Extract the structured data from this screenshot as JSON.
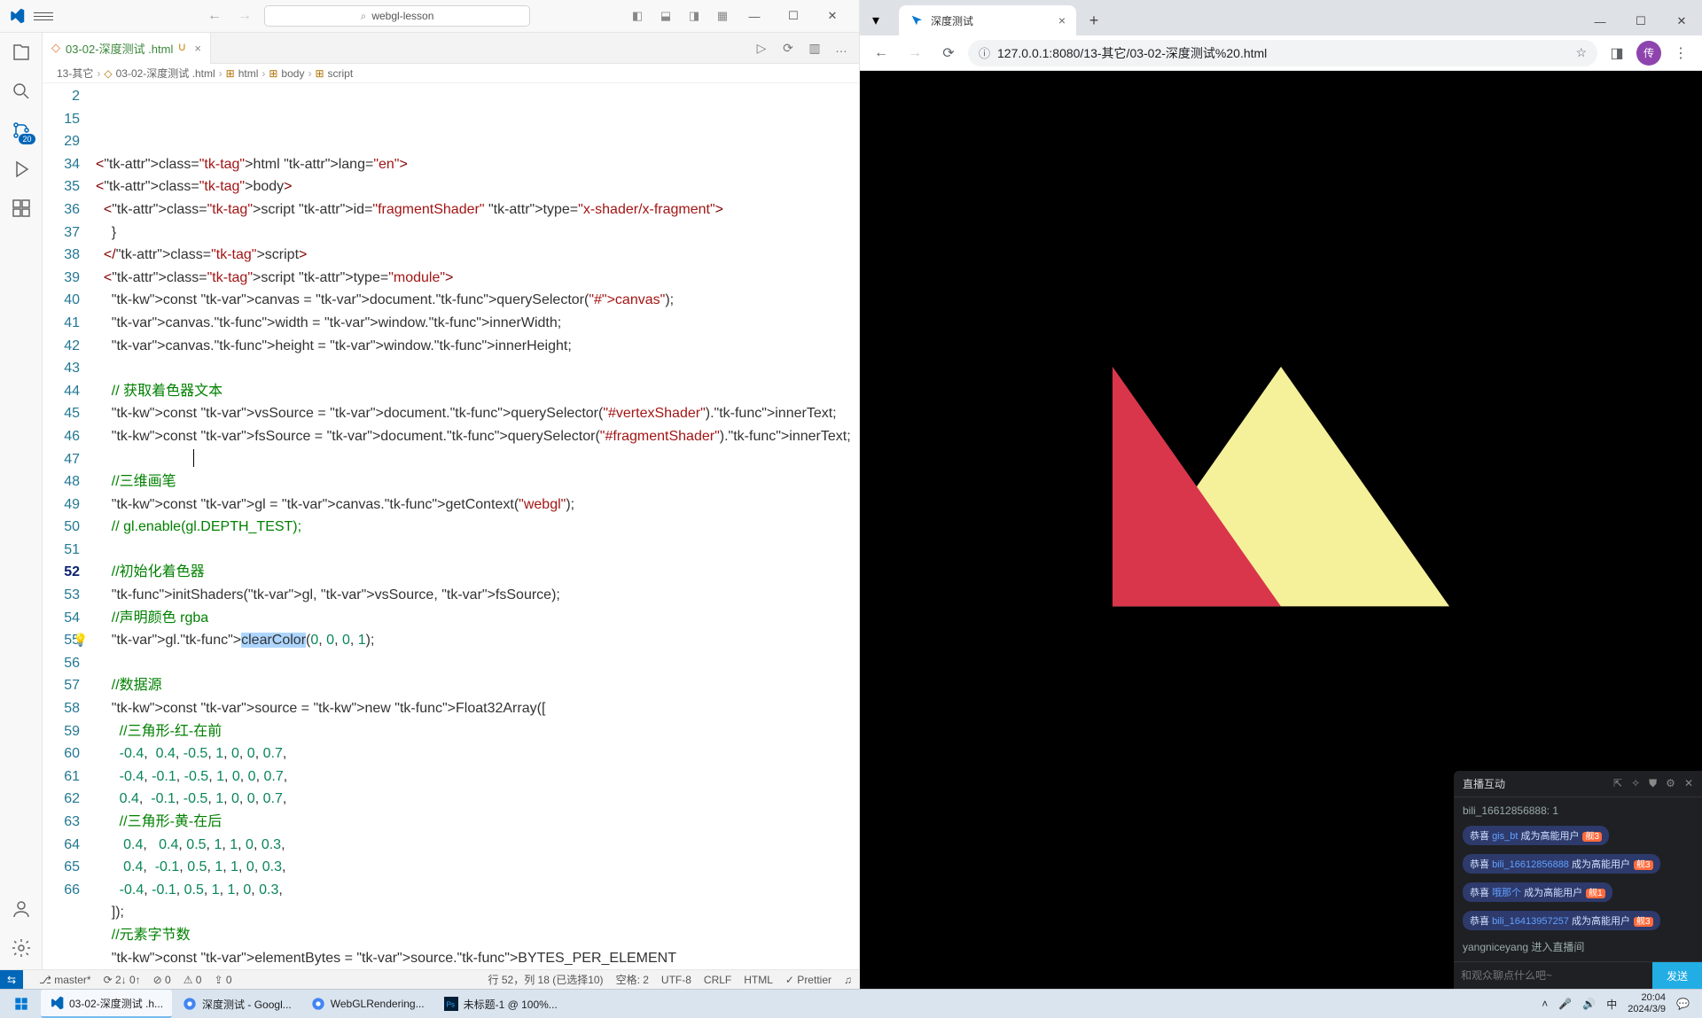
{
  "vscode": {
    "search_placeholder": "webgl-lesson",
    "tab": {
      "label": "03-02-深度测试 .html",
      "modified": "U"
    },
    "editor_actions": {
      "run": "▷",
      "debug": "⟳",
      "split": "▥",
      "more": "…"
    },
    "breadcrumb": [
      "13-其它",
      "03-02-深度测试 .html",
      "html",
      "body",
      "script"
    ],
    "activity_badge": "20",
    "code": {
      "line_numbers": [
        2,
        15,
        29,
        34,
        35,
        36,
        37,
        38,
        39,
        40,
        41,
        42,
        43,
        44,
        45,
        46,
        47,
        48,
        49,
        50,
        51,
        52,
        53,
        54,
        55,
        56,
        57,
        58,
        59,
        60,
        61,
        62,
        63,
        64,
        65,
        66
      ],
      "current_line": 52,
      "lines": [
        {
          "raw": "<html lang=\"en\">",
          "type": "html"
        },
        {
          "raw": "<body>",
          "type": "html"
        },
        {
          "raw": "  <script id=\"fragmentShader\" type=\"x-shader/x-fragment\">",
          "type": "html"
        },
        {
          "raw": "    }",
          "type": "plain"
        },
        {
          "raw": "  </script>",
          "type": "html"
        },
        {
          "raw": "  <script type=\"module\">",
          "type": "html"
        },
        {
          "raw": "    const canvas = document.querySelector(\"#canvas\");",
          "type": "js"
        },
        {
          "raw": "    canvas.width = window.innerWidth;",
          "type": "js"
        },
        {
          "raw": "    canvas.height = window.innerHeight;",
          "type": "js"
        },
        {
          "raw": "",
          "type": "plain"
        },
        {
          "raw": "    // 获取着色器文本",
          "type": "cmt"
        },
        {
          "raw": "    const vsSource = document.querySelector(\"#vertexShader\").innerText;",
          "type": "js"
        },
        {
          "raw": "    const fsSource = document.querySelector(\"#fragmentShader\").innerText;",
          "type": "js"
        },
        {
          "raw": "",
          "type": "plain"
        },
        {
          "raw": "    //三维画笔",
          "type": "cmt"
        },
        {
          "raw": "    const gl = canvas.getContext(\"webgl\");",
          "type": "js"
        },
        {
          "raw": "    // gl.enable(gl.DEPTH_TEST);",
          "type": "cmt"
        },
        {
          "raw": "",
          "type": "plain"
        },
        {
          "raw": "    //初始化着色器",
          "type": "cmt"
        },
        {
          "raw": "    initShaders(gl, vsSource, fsSource);",
          "type": "js"
        },
        {
          "raw": "    //声明颜色 rgba",
          "type": "cmt"
        },
        {
          "raw": "    gl.clearColor(0, 0, 0, 1);",
          "type": "js",
          "sel": "clearColor",
          "bulb": true
        },
        {
          "raw": "",
          "type": "plain"
        },
        {
          "raw": "    //数据源",
          "type": "cmt"
        },
        {
          "raw": "    const source = new Float32Array([",
          "type": "js"
        },
        {
          "raw": "      //三角形-红-在前",
          "type": "cmt"
        },
        {
          "raw": "      -0.4,  0.4, -0.5, 1, 0, 0, 0.7,",
          "type": "nums"
        },
        {
          "raw": "      -0.4, -0.1, -0.5, 1, 0, 0, 0.7,",
          "type": "nums"
        },
        {
          "raw": "      0.4,  -0.1, -0.5, 1, 0, 0, 0.7,",
          "type": "nums"
        },
        {
          "raw": "      //三角形-黄-在后",
          "type": "cmt"
        },
        {
          "raw": "       0.4,   0.4, 0.5, 1, 1, 0, 0.3,",
          "type": "nums"
        },
        {
          "raw": "       0.4,  -0.1, 0.5, 1, 1, 0, 0.3,",
          "type": "nums"
        },
        {
          "raw": "      -0.4, -0.1, 0.5, 1, 1, 0, 0.3,",
          "type": "nums"
        },
        {
          "raw": "    ]);",
          "type": "js"
        },
        {
          "raw": "    //元素字节数",
          "type": "cmt"
        },
        {
          "raw": "    const elementBytes = source.BYTES_PER_ELEMENT",
          "type": "js"
        }
      ]
    },
    "status": {
      "remote": "⇆",
      "branch": "master*",
      "sync": "⟳ 2↓ 0↑",
      "errors": "⊘ 0",
      "warnings": "⚠ 0",
      "ports": "⇪ 0",
      "cursor": "行 52，列 18 (已选择10)",
      "spaces": "空格: 2",
      "encoding": "UTF-8",
      "eol": "CRLF",
      "lang": "HTML",
      "prettier": "✓ Prettier",
      "bell": "♫"
    }
  },
  "chrome": {
    "tab_title": "深度测试",
    "url": "127.0.0.1:8080/13-其它/03-02-深度测试%20.html",
    "avatar_initial": "传"
  },
  "livechat": {
    "title": "直播互动",
    "messages": [
      {
        "type": "plain",
        "text": "bili_16612856888: 1"
      },
      {
        "type": "badge",
        "prefix": "恭喜 ",
        "user": "gis_bt",
        "suffix": " 成为高能用户",
        "level": "舰3"
      },
      {
        "type": "badge",
        "prefix": "恭喜 ",
        "user": "bili_16612856888",
        "suffix": " 成为高能用户",
        "level": "舰3"
      },
      {
        "type": "badge",
        "prefix": "恭喜 ",
        "user": "哦那个",
        "suffix": " 成为高能用户",
        "level": "舰1"
      },
      {
        "type": "badge",
        "prefix": "恭喜 ",
        "user": "bili_16413957257",
        "suffix": " 成为高能用户",
        "level": "舰3"
      },
      {
        "type": "plain",
        "text": "yangniceyang 进入直播间"
      }
    ],
    "input_placeholder": "和观众聊点什么吧~",
    "send_label": "发送"
  },
  "taskbar": {
    "items": [
      {
        "label": "03-02-深度测试 .h...",
        "active": true,
        "icon": "vscode"
      },
      {
        "label": "深度测试 - Googl...",
        "active": false,
        "icon": "chrome"
      },
      {
        "label": "WebGLRendering...",
        "active": false,
        "icon": "chrome"
      },
      {
        "label": "未标题-1 @ 100%...",
        "active": false,
        "icon": "ps"
      }
    ],
    "tray": {
      "ime": "中",
      "time": "20:04",
      "date": "2024/3/9"
    }
  }
}
